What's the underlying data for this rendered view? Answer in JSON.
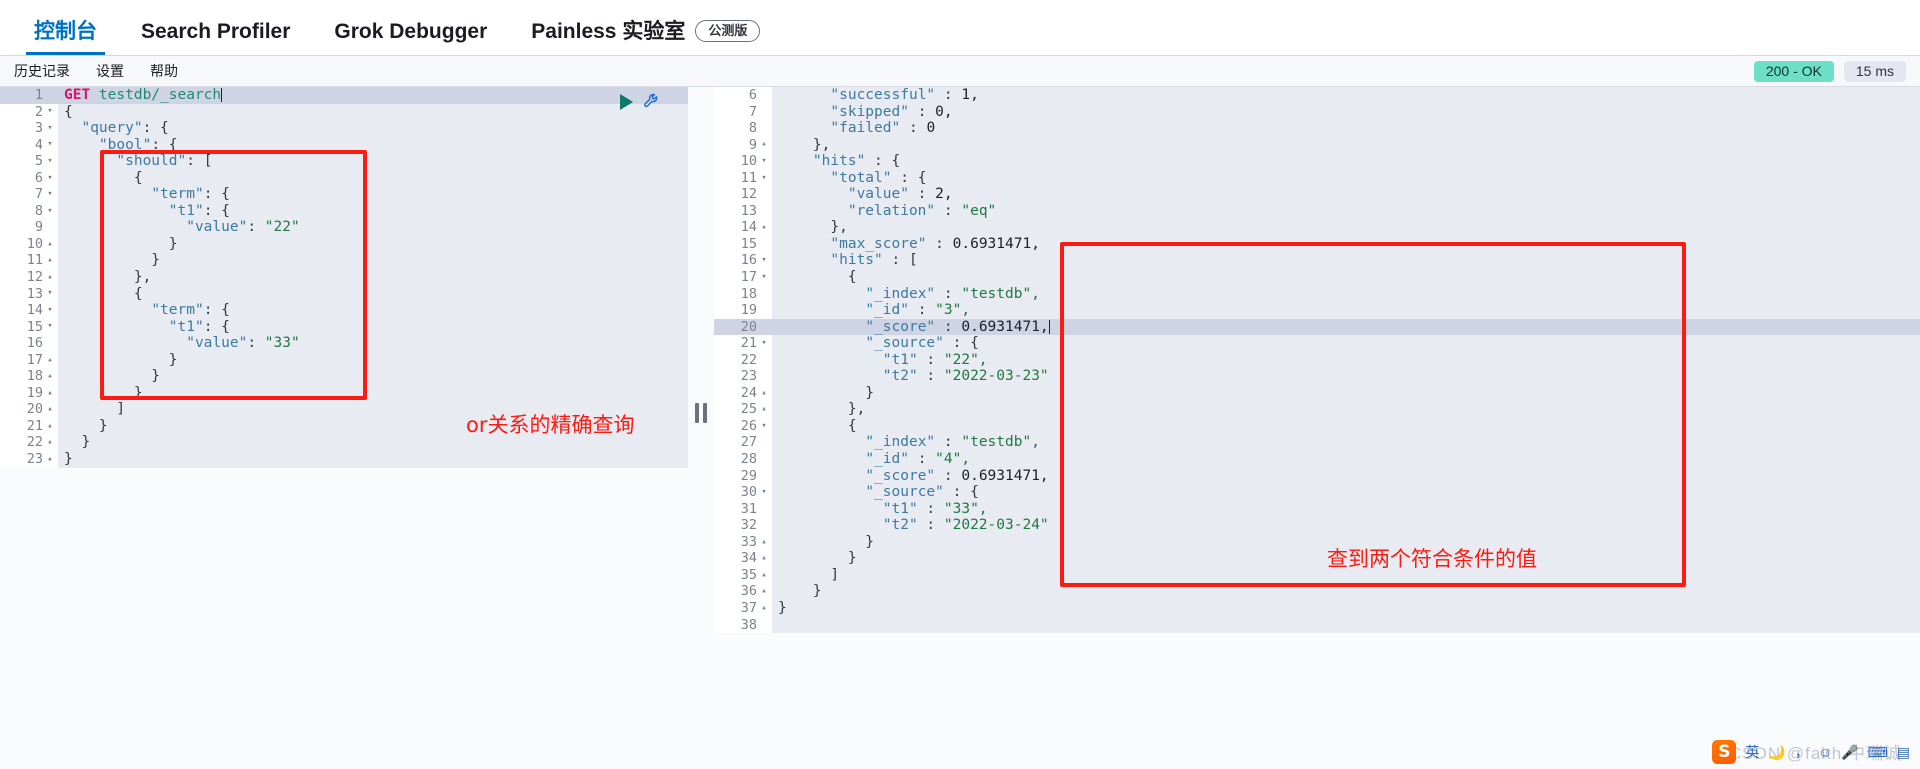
{
  "topbar": {
    "tabs": [
      {
        "label": "控制台",
        "active": true
      },
      {
        "label": "Search Profiler",
        "active": false
      },
      {
        "label": "Grok Debugger",
        "active": false
      },
      {
        "label": "Painless 实验室",
        "active": false,
        "badge": "公测版"
      }
    ]
  },
  "subbar": {
    "items": [
      {
        "label": "历史记录"
      },
      {
        "label": "设置"
      },
      {
        "label": "帮助"
      }
    ],
    "status_code": "200 - OK",
    "status_time": "15 ms"
  },
  "editor": {
    "icons": {
      "run": "play-icon",
      "wrench": "wrench-icon"
    },
    "lines": [
      {
        "n": "1",
        "fold": "",
        "hl": true,
        "tokens": [
          {
            "t": "GET ",
            "c": "method"
          },
          {
            "t": "testdb/_search",
            "c": "url"
          },
          {
            "t": "",
            "c": "caret"
          }
        ]
      },
      {
        "n": "2",
        "fold": "▾",
        "tokens": [
          {
            "t": "{",
            "c": "pn"
          }
        ]
      },
      {
        "n": "3",
        "fold": "▾",
        "tokens": [
          {
            "t": "  ",
            "c": "pn"
          },
          {
            "t": "\"query\"",
            "c": "k"
          },
          {
            "t": ": {",
            "c": "pn"
          }
        ]
      },
      {
        "n": "4",
        "fold": "▾",
        "tokens": [
          {
            "t": "    ",
            "c": "pn"
          },
          {
            "t": "\"bool\"",
            "c": "k"
          },
          {
            "t": ": {",
            "c": "pn"
          }
        ]
      },
      {
        "n": "5",
        "fold": "▾",
        "tokens": [
          {
            "t": "      ",
            "c": "pn"
          },
          {
            "t": "\"should\"",
            "c": "k"
          },
          {
            "t": ": [",
            "c": "pn"
          }
        ]
      },
      {
        "n": "6",
        "fold": "▾",
        "tokens": [
          {
            "t": "        {",
            "c": "pn"
          }
        ]
      },
      {
        "n": "7",
        "fold": "▾",
        "tokens": [
          {
            "t": "          ",
            "c": "pn"
          },
          {
            "t": "\"term\"",
            "c": "k"
          },
          {
            "t": ": {",
            "c": "pn"
          }
        ]
      },
      {
        "n": "8",
        "fold": "▾",
        "tokens": [
          {
            "t": "            ",
            "c": "pn"
          },
          {
            "t": "\"t1\"",
            "c": "k"
          },
          {
            "t": ": {",
            "c": "pn"
          }
        ]
      },
      {
        "n": "9",
        "fold": "",
        "tokens": [
          {
            "t": "              ",
            "c": "pn"
          },
          {
            "t": "\"value\"",
            "c": "k"
          },
          {
            "t": ": ",
            "c": "pn"
          },
          {
            "t": "\"22\"",
            "c": "s"
          }
        ]
      },
      {
        "n": "10",
        "fold": "▴",
        "tokens": [
          {
            "t": "            }",
            "c": "pn"
          }
        ]
      },
      {
        "n": "11",
        "fold": "▴",
        "tokens": [
          {
            "t": "          }",
            "c": "pn"
          }
        ]
      },
      {
        "n": "12",
        "fold": "▴",
        "tokens": [
          {
            "t": "        },",
            "c": "pn"
          }
        ]
      },
      {
        "n": "13",
        "fold": "▾",
        "tokens": [
          {
            "t": "        {",
            "c": "pn"
          }
        ]
      },
      {
        "n": "14",
        "fold": "▾",
        "tokens": [
          {
            "t": "          ",
            "c": "pn"
          },
          {
            "t": "\"term\"",
            "c": "k"
          },
          {
            "t": ": {",
            "c": "pn"
          }
        ]
      },
      {
        "n": "15",
        "fold": "▾",
        "tokens": [
          {
            "t": "            ",
            "c": "pn"
          },
          {
            "t": "\"t1\"",
            "c": "k"
          },
          {
            "t": ": {",
            "c": "pn"
          }
        ]
      },
      {
        "n": "16",
        "fold": "",
        "tokens": [
          {
            "t": "              ",
            "c": "pn"
          },
          {
            "t": "\"value\"",
            "c": "k"
          },
          {
            "t": ": ",
            "c": "pn"
          },
          {
            "t": "\"33\"",
            "c": "s"
          }
        ]
      },
      {
        "n": "17",
        "fold": "▴",
        "tokens": [
          {
            "t": "            }",
            "c": "pn"
          }
        ]
      },
      {
        "n": "18",
        "fold": "▴",
        "tokens": [
          {
            "t": "          }",
            "c": "pn"
          }
        ]
      },
      {
        "n": "19",
        "fold": "▴",
        "tokens": [
          {
            "t": "        }",
            "c": "pn"
          }
        ]
      },
      {
        "n": "20",
        "fold": "▴",
        "tokens": [
          {
            "t": "      ]",
            "c": "pn"
          }
        ]
      },
      {
        "n": "21",
        "fold": "▴",
        "tokens": [
          {
            "t": "    }",
            "c": "pn"
          }
        ]
      },
      {
        "n": "22",
        "fold": "▴",
        "tokens": [
          {
            "t": "  }",
            "c": "pn"
          }
        ]
      },
      {
        "n": "23",
        "fold": "▴",
        "tokens": [
          {
            "t": "}",
            "c": "pn"
          }
        ]
      }
    ]
  },
  "response": {
    "lines": [
      {
        "n": "6",
        "fold": "",
        "clip": true,
        "tokens": [
          {
            "t": "      ",
            "c": "pn"
          },
          {
            "t": "\"successful\"",
            "c": "k"
          },
          {
            "t": " : ",
            "c": "pn"
          },
          {
            "t": "1,",
            "c": "num2"
          }
        ]
      },
      {
        "n": "7",
        "fold": "",
        "tokens": [
          {
            "t": "      ",
            "c": "pn"
          },
          {
            "t": "\"skipped\"",
            "c": "k"
          },
          {
            "t": " : ",
            "c": "pn"
          },
          {
            "t": "0,",
            "c": "num2"
          }
        ]
      },
      {
        "n": "8",
        "fold": "",
        "tokens": [
          {
            "t": "      ",
            "c": "pn"
          },
          {
            "t": "\"failed\"",
            "c": "k"
          },
          {
            "t": " : ",
            "c": "pn"
          },
          {
            "t": "0",
            "c": "num2"
          }
        ]
      },
      {
        "n": "9",
        "fold": "▴",
        "tokens": [
          {
            "t": "    },",
            "c": "pn"
          }
        ]
      },
      {
        "n": "10",
        "fold": "▾",
        "tokens": [
          {
            "t": "    ",
            "c": "pn"
          },
          {
            "t": "\"hits\"",
            "c": "k"
          },
          {
            "t": " : {",
            "c": "pn"
          }
        ]
      },
      {
        "n": "11",
        "fold": "▾",
        "tokens": [
          {
            "t": "      ",
            "c": "pn"
          },
          {
            "t": "\"total\"",
            "c": "k"
          },
          {
            "t": " : {",
            "c": "pn"
          }
        ]
      },
      {
        "n": "12",
        "fold": "",
        "tokens": [
          {
            "t": "        ",
            "c": "pn"
          },
          {
            "t": "\"value\"",
            "c": "k"
          },
          {
            "t": " : ",
            "c": "pn"
          },
          {
            "t": "2,",
            "c": "num2"
          }
        ]
      },
      {
        "n": "13",
        "fold": "",
        "tokens": [
          {
            "t": "        ",
            "c": "pn"
          },
          {
            "t": "\"relation\"",
            "c": "k"
          },
          {
            "t": " : ",
            "c": "pn"
          },
          {
            "t": "\"eq\"",
            "c": "s"
          }
        ]
      },
      {
        "n": "14",
        "fold": "▴",
        "tokens": [
          {
            "t": "      },",
            "c": "pn"
          }
        ]
      },
      {
        "n": "15",
        "fold": "",
        "tokens": [
          {
            "t": "      ",
            "c": "pn"
          },
          {
            "t": "\"max_score\"",
            "c": "k"
          },
          {
            "t": " : ",
            "c": "pn"
          },
          {
            "t": "0.6931471,",
            "c": "num2"
          }
        ]
      },
      {
        "n": "16",
        "fold": "▾",
        "tokens": [
          {
            "t": "      ",
            "c": "pn"
          },
          {
            "t": "\"hits\"",
            "c": "k"
          },
          {
            "t": " : [",
            "c": "pn"
          }
        ]
      },
      {
        "n": "17",
        "fold": "▾",
        "tokens": [
          {
            "t": "        {",
            "c": "pn"
          }
        ]
      },
      {
        "n": "18",
        "fold": "",
        "tokens": [
          {
            "t": "          ",
            "c": "pn"
          },
          {
            "t": "\"_index\"",
            "c": "k"
          },
          {
            "t": " : ",
            "c": "pn"
          },
          {
            "t": "\"testdb\",",
            "c": "s"
          }
        ]
      },
      {
        "n": "19",
        "fold": "",
        "tokens": [
          {
            "t": "          ",
            "c": "pn"
          },
          {
            "t": "\"_id\"",
            "c": "k"
          },
          {
            "t": " : ",
            "c": "pn"
          },
          {
            "t": "\"3\",",
            "c": "s"
          }
        ]
      },
      {
        "n": "20",
        "fold": "",
        "hl": true,
        "tokens": [
          {
            "t": "          ",
            "c": "pn"
          },
          {
            "t": "\"_score\"",
            "c": "k"
          },
          {
            "t": " : ",
            "c": "pn"
          },
          {
            "t": "0.6931471,",
            "c": "num2"
          },
          {
            "t": "",
            "c": "caret"
          }
        ]
      },
      {
        "n": "21",
        "fold": "▾",
        "tokens": [
          {
            "t": "          ",
            "c": "pn"
          },
          {
            "t": "\"_source\"",
            "c": "k"
          },
          {
            "t": " : {",
            "c": "pn"
          }
        ]
      },
      {
        "n": "22",
        "fold": "",
        "tokens": [
          {
            "t": "            ",
            "c": "pn"
          },
          {
            "t": "\"t1\"",
            "c": "k"
          },
          {
            "t": " : ",
            "c": "pn"
          },
          {
            "t": "\"22\",",
            "c": "s"
          }
        ]
      },
      {
        "n": "23",
        "fold": "",
        "tokens": [
          {
            "t": "            ",
            "c": "pn"
          },
          {
            "t": "\"t2\"",
            "c": "k"
          },
          {
            "t": " : ",
            "c": "pn"
          },
          {
            "t": "\"2022-03-23\"",
            "c": "s"
          }
        ]
      },
      {
        "n": "24",
        "fold": "▴",
        "tokens": [
          {
            "t": "          }",
            "c": "pn"
          }
        ]
      },
      {
        "n": "25",
        "fold": "▴",
        "tokens": [
          {
            "t": "        },",
            "c": "pn"
          }
        ]
      },
      {
        "n": "26",
        "fold": "▾",
        "tokens": [
          {
            "t": "        {",
            "c": "pn"
          }
        ]
      },
      {
        "n": "27",
        "fold": "",
        "tokens": [
          {
            "t": "          ",
            "c": "pn"
          },
          {
            "t": "\"_index\"",
            "c": "k"
          },
          {
            "t": " : ",
            "c": "pn"
          },
          {
            "t": "\"testdb\",",
            "c": "s"
          }
        ]
      },
      {
        "n": "28",
        "fold": "",
        "tokens": [
          {
            "t": "          ",
            "c": "pn"
          },
          {
            "t": "\"_id\"",
            "c": "k"
          },
          {
            "t": " : ",
            "c": "pn"
          },
          {
            "t": "\"4\",",
            "c": "s"
          }
        ]
      },
      {
        "n": "29",
        "fold": "",
        "tokens": [
          {
            "t": "          ",
            "c": "pn"
          },
          {
            "t": "\"_score\"",
            "c": "k"
          },
          {
            "t": " : ",
            "c": "pn"
          },
          {
            "t": "0.6931471,",
            "c": "num2"
          }
        ]
      },
      {
        "n": "30",
        "fold": "▾",
        "tokens": [
          {
            "t": "          ",
            "c": "pn"
          },
          {
            "t": "\"_source\"",
            "c": "k"
          },
          {
            "t": " : {",
            "c": "pn"
          }
        ]
      },
      {
        "n": "31",
        "fold": "",
        "tokens": [
          {
            "t": "            ",
            "c": "pn"
          },
          {
            "t": "\"t1\"",
            "c": "k"
          },
          {
            "t": " : ",
            "c": "pn"
          },
          {
            "t": "\"33\",",
            "c": "s"
          }
        ]
      },
      {
        "n": "32",
        "fold": "",
        "tokens": [
          {
            "t": "            ",
            "c": "pn"
          },
          {
            "t": "\"t2\"",
            "c": "k"
          },
          {
            "t": " : ",
            "c": "pn"
          },
          {
            "t": "\"2022-03-24\"",
            "c": "s"
          }
        ]
      },
      {
        "n": "33",
        "fold": "▴",
        "tokens": [
          {
            "t": "          }",
            "c": "pn"
          }
        ]
      },
      {
        "n": "34",
        "fold": "▴",
        "tokens": [
          {
            "t": "        }",
            "c": "pn"
          }
        ]
      },
      {
        "n": "35",
        "fold": "▴",
        "tokens": [
          {
            "t": "      ]",
            "c": "pn"
          }
        ]
      },
      {
        "n": "36",
        "fold": "▴",
        "tokens": [
          {
            "t": "    }",
            "c": "pn"
          }
        ]
      },
      {
        "n": "37",
        "fold": "▴",
        "tokens": [
          {
            "t": "}",
            "c": "pn"
          }
        ]
      },
      {
        "n": "38",
        "fold": "",
        "tokens": [
          {
            "t": "",
            "c": "pn"
          }
        ]
      }
    ]
  },
  "annotations": {
    "left_note": "or关系的精确查询",
    "right_note": "查到两个符合条件的值",
    "accent_color": "#fb1b11"
  },
  "ime": {
    "logo": "S",
    "lang": "英",
    "icons": [
      "moon-icon",
      "comma-icon",
      "smiley-icon",
      "microphone-icon",
      "keyboard-icon",
      "toolbox-icon"
    ]
  },
  "watermark": "CSDN @faith 中瑞诚"
}
